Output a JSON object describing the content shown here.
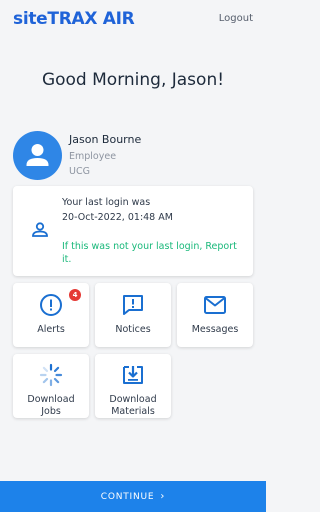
{
  "header": {
    "logo": "siteTRAX AIR",
    "logout_label": "Logout"
  },
  "greeting": "Good Morning, Jason!",
  "user": {
    "name": "Jason Bourne",
    "role": "Employee",
    "org": "UCG",
    "avatar_icon": "person-icon"
  },
  "last_login": {
    "line1": "Your last login was",
    "timestamp": "20-Oct-2022, 01:48 AM",
    "warning": "If this was not your last login, Report it.",
    "icon": "user-icon"
  },
  "tiles": [
    {
      "label": "Alerts",
      "icon": "alert-circle-icon",
      "badge": "4"
    },
    {
      "label": "Notices",
      "icon": "notice-bubble-icon"
    },
    {
      "label": "Messages",
      "icon": "mail-icon"
    },
    {
      "label": "Download\nJobs",
      "icon": "loading-spinner-icon"
    },
    {
      "label": "Download\nMaterials",
      "icon": "download-tray-icon"
    }
  ],
  "continue": {
    "label": "CONTINUE",
    "icon": "chevron-right-icon"
  },
  "colors": {
    "brand": "#1f63d8",
    "primary_button": "#1d82ea",
    "avatar": "#2f86e6",
    "warning_text": "#19b87a",
    "badge": "#e53935",
    "icon": "#1a6fd1"
  }
}
